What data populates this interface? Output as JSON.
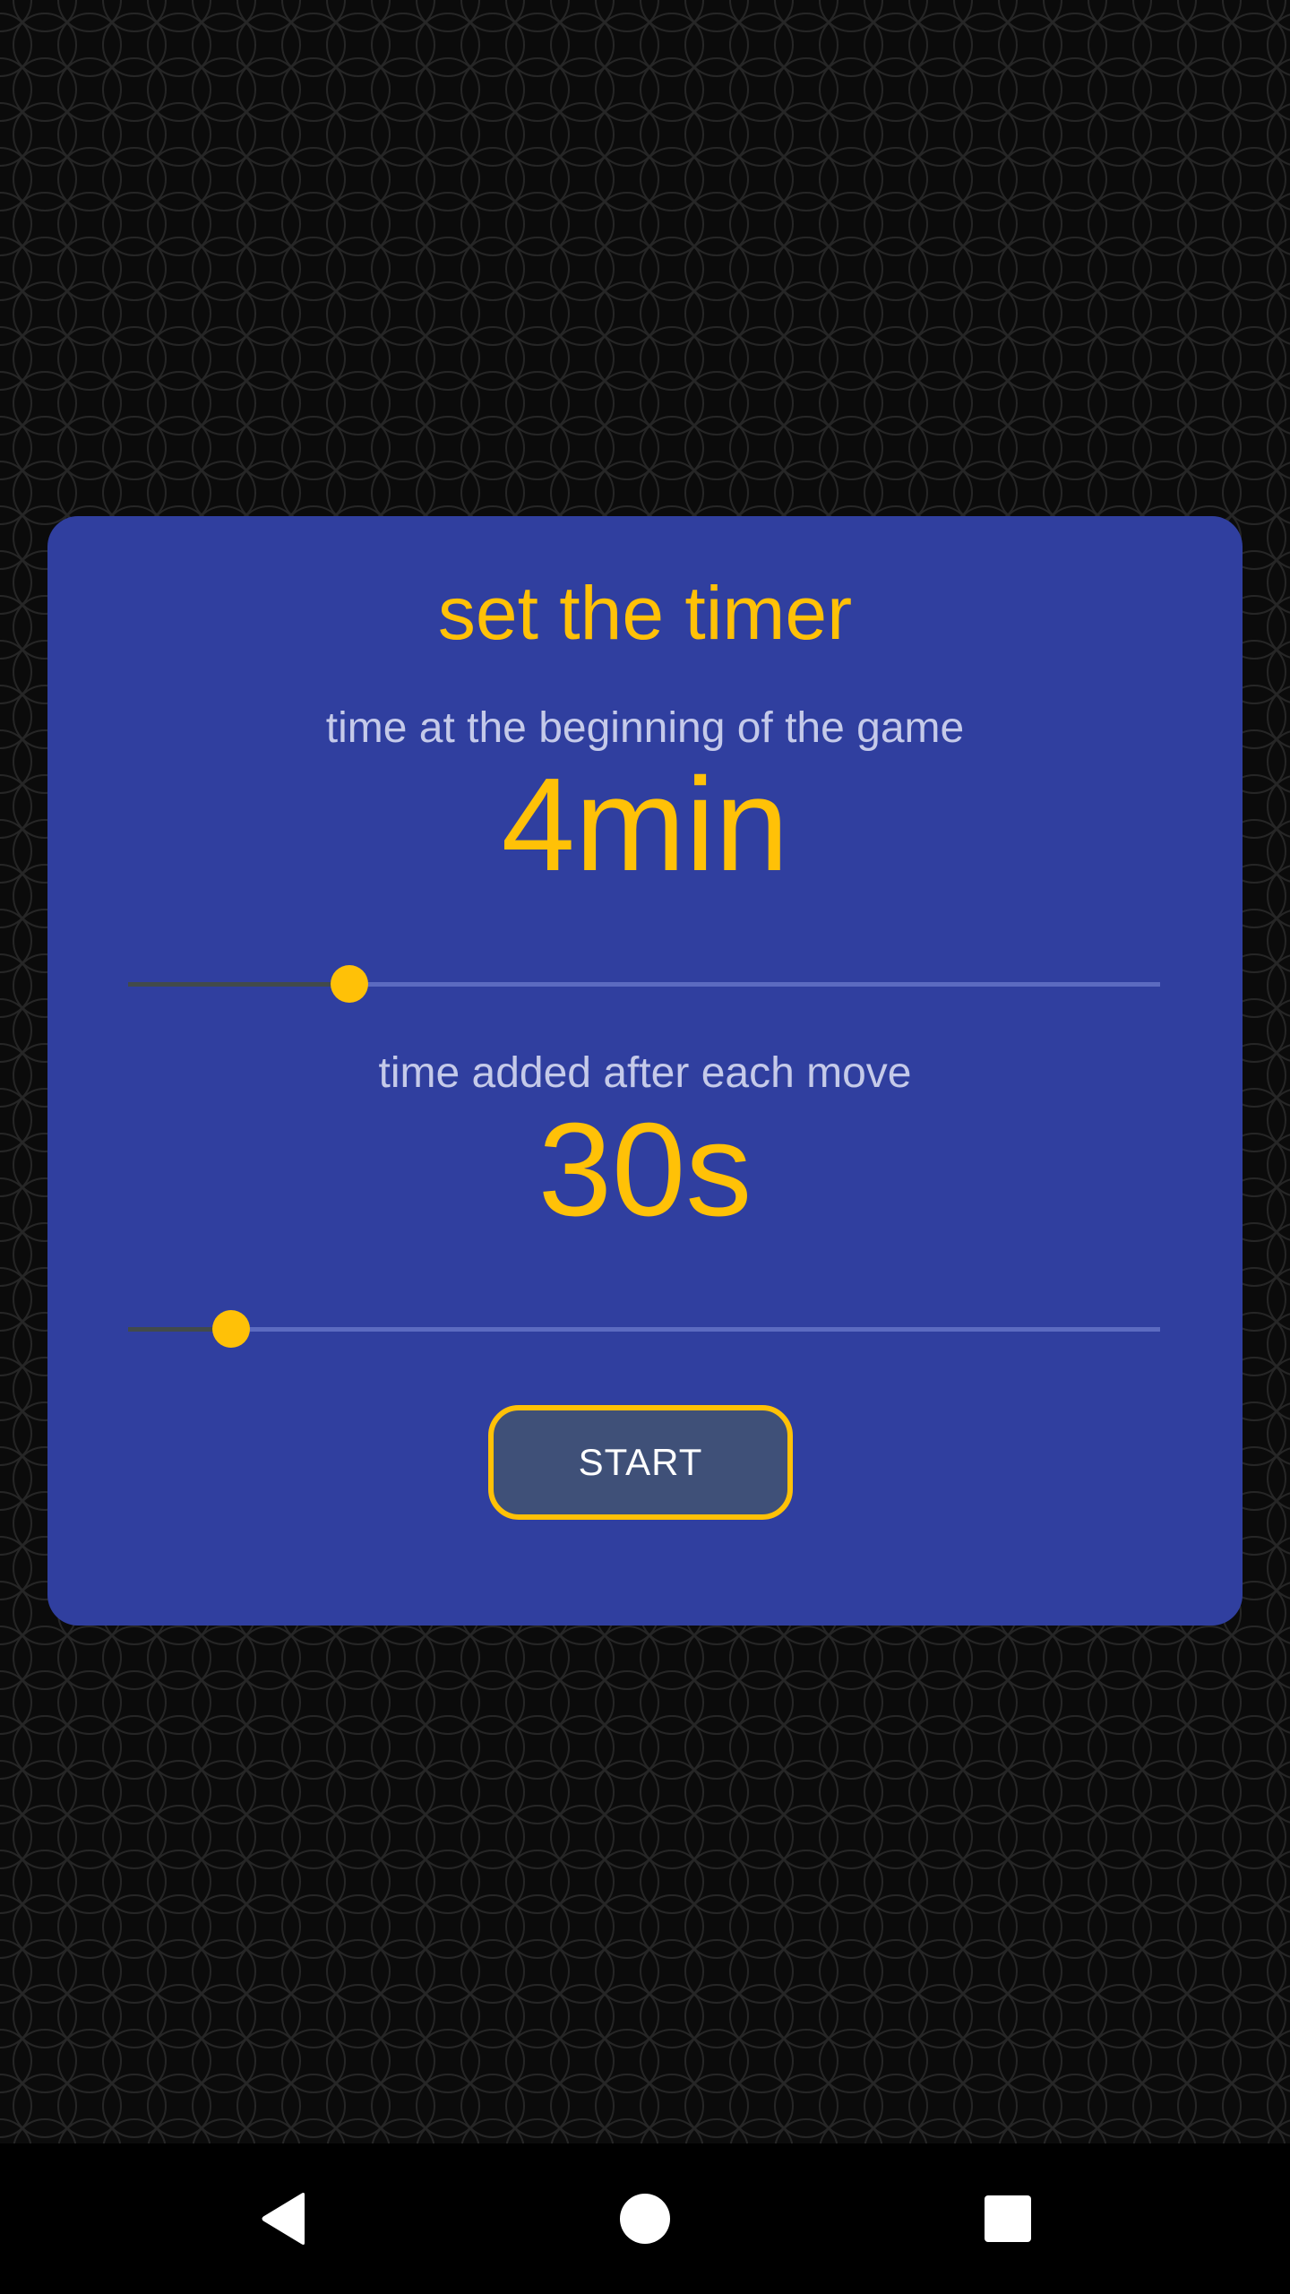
{
  "timer_setup": {
    "title": "set the timer",
    "initial_time": {
      "label": "time at the beginning of the game",
      "value": "4min",
      "slider_fraction": 0.214
    },
    "increment": {
      "label": "time added after each move",
      "value": "30s",
      "slider_fraction": 0.1
    },
    "start_label": "START"
  },
  "colors": {
    "card": "#303f9f",
    "accent": "#ffc107",
    "label_text": "#c5cae9",
    "slider_track": "#5c6bc0",
    "slider_fill": "#424a4a",
    "button_fill": "#3f5078",
    "background": "#0b0b0b",
    "pattern_stroke": "#262626"
  },
  "nav_bar": {
    "back_icon": "triangle-back-icon",
    "home_icon": "circle-home-icon",
    "recents_icon": "square-recents-icon"
  }
}
